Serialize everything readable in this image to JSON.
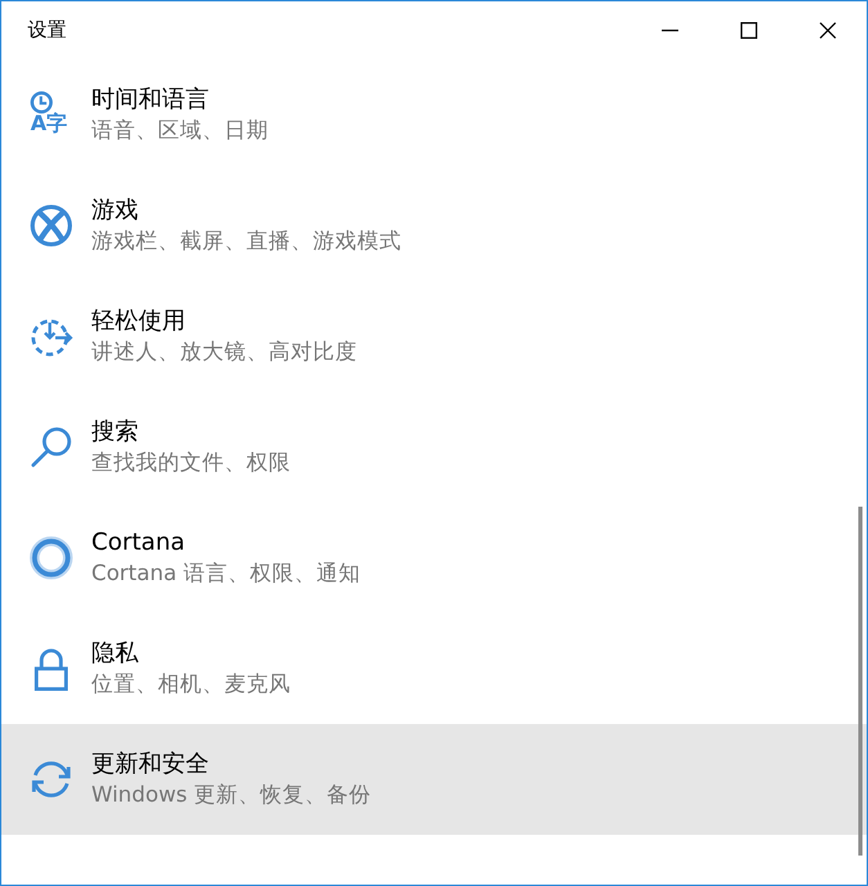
{
  "window": {
    "title": "设置"
  },
  "items": [
    {
      "kind": "time-language",
      "title": "时间和语言",
      "subtitle": "语音、区域、日期",
      "icon_text": "A字",
      "selected": false
    },
    {
      "kind": "gaming",
      "title": "游戏",
      "subtitle": "游戏栏、截屏、直播、游戏模式",
      "selected": false
    },
    {
      "kind": "ease-of-access",
      "title": "轻松使用",
      "subtitle": "讲述人、放大镜、高对比度",
      "selected": false
    },
    {
      "kind": "search",
      "title": "搜索",
      "subtitle": "查找我的文件、权限",
      "selected": false
    },
    {
      "kind": "cortana",
      "title": "Cortana",
      "subtitle": "Cortana 语言、权限、通知",
      "selected": false
    },
    {
      "kind": "privacy",
      "title": "隐私",
      "subtitle": "位置、相机、麦克风",
      "selected": false
    },
    {
      "kind": "update-security",
      "title": "更新和安全",
      "subtitle": "Windows 更新、恢复、备份",
      "selected": true
    }
  ]
}
